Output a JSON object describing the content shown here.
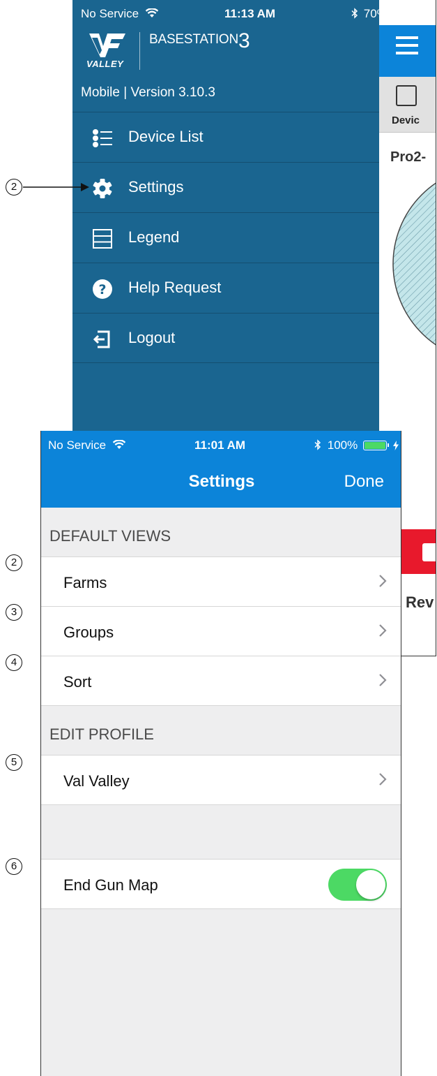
{
  "menu_screen": {
    "status": {
      "carrier": "No Service",
      "time": "11:13 AM",
      "battery": "70%",
      "battery_level": 0.7
    },
    "logo": {
      "brand": "VALLEY",
      "app_name": "BASESTATION",
      "app_suffix": "3"
    },
    "version": "Mobile | Version 3.10.3",
    "items": [
      {
        "label": "Device List",
        "icon": "list-icon"
      },
      {
        "label": "Settings",
        "icon": "gear-icon"
      },
      {
        "label": "Legend",
        "icon": "legend-icon"
      },
      {
        "label": "Help Request",
        "icon": "help-icon"
      },
      {
        "label": "Logout",
        "icon": "logout-icon"
      }
    ],
    "main": {
      "tab_label": "Devic",
      "device_name": "Pro2-",
      "bottom_label": "Rev"
    },
    "colors": {
      "menu_bg": "#1a6590",
      "header_blue": "#0c84d9",
      "alert_red": "#e8192c"
    }
  },
  "settings_screen": {
    "status": {
      "carrier": "No Service",
      "time": "11:01 AM",
      "battery": "100%",
      "battery_level": 1.0
    },
    "nav": {
      "title": "Settings",
      "done_label": "Done"
    },
    "sections": [
      {
        "header": "DEFAULT VIEWS",
        "rows": [
          "Farms",
          "Groups",
          "Sort"
        ]
      },
      {
        "header": "EDIT PROFILE",
        "rows": [
          "Val Valley"
        ]
      }
    ],
    "end_gun_map": {
      "label": "End Gun Map",
      "enabled": true
    },
    "colors": {
      "toggle_on": "#4cd964",
      "nav_blue": "#0c84d9",
      "background": "#eeeeef"
    }
  },
  "callouts": {
    "menu_settings": "2",
    "farms": "2",
    "groups": "3",
    "sort": "4",
    "profile": "5",
    "end_gun_map": "6"
  }
}
